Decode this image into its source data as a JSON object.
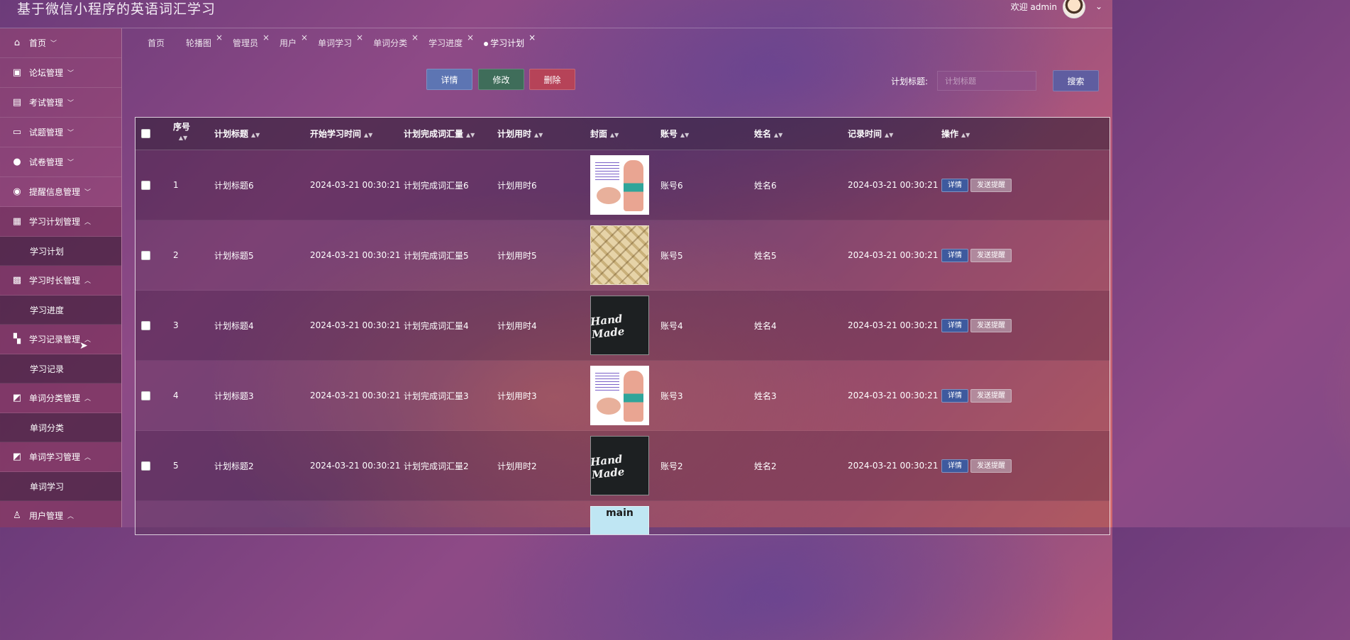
{
  "app": {
    "title": "基于微信小程序的英语词汇学习",
    "welcome": "欢迎 admin"
  },
  "sidebar": {
    "items": [
      {
        "label": "首页",
        "icon": "home-icon",
        "open": false
      },
      {
        "label": "论坛管理",
        "icon": "forum-icon",
        "open": false
      },
      {
        "label": "考试管理",
        "icon": "exam-icon",
        "open": false
      },
      {
        "label": "试题管理",
        "icon": "question-icon",
        "open": false
      },
      {
        "label": "试卷管理",
        "icon": "paper-icon",
        "open": false
      },
      {
        "label": "提醒信息管理",
        "icon": "compass-icon",
        "open": false
      },
      {
        "label": "学习计划管理",
        "icon": "briefcase-icon",
        "open": true,
        "sub": "学习计划"
      },
      {
        "label": "学习时长管理",
        "icon": "chip-icon",
        "open": true,
        "sub": "学习进度"
      },
      {
        "label": "学习记录管理",
        "icon": "grid-icon",
        "open": true,
        "sub": "学习记录"
      },
      {
        "label": "单词分类管理",
        "icon": "chart-icon",
        "open": true,
        "sub": "单词分类"
      },
      {
        "label": "单词学习管理",
        "icon": "chart-icon",
        "open": true,
        "sub": "单词学习"
      },
      {
        "label": "用户管理",
        "icon": "user-icon",
        "open": true
      }
    ]
  },
  "tabs": [
    "首页",
    "轮播图",
    "管理员",
    "用户",
    "单词学习",
    "单词分类",
    "学习进度",
    "学习计划"
  ],
  "toolbar": {
    "detail": "详情",
    "edit": "修改",
    "delete": "删除",
    "search_label": "计划标题:",
    "search_placeholder": "计划标题",
    "search": "搜索"
  },
  "table": {
    "headers": {
      "seq": "序号",
      "title": "计划标题",
      "start": "开始学习时间",
      "words": "计划完成词汇量",
      "hours": "计划用时",
      "cover": "封面",
      "account": "账号",
      "name": "姓名",
      "time": "记录时间",
      "op": "操作"
    },
    "rows": [
      {
        "no": "1",
        "title": "计划标题6",
        "start": "2024-03-21 00:30:21",
        "words": "计划完成词汇量6",
        "hours": "计划用时6",
        "cover": "anatomy",
        "account": "账号6",
        "name": "姓名6",
        "time": "2024-03-21 00:30:21"
      },
      {
        "no": "2",
        "title": "计划标题5",
        "start": "2024-03-21 00:30:21",
        "words": "计划完成词汇量5",
        "hours": "计划用时5",
        "cover": "dice",
        "account": "账号5",
        "name": "姓名5",
        "time": "2024-03-21 00:30:21"
      },
      {
        "no": "3",
        "title": "计划标题4",
        "start": "2024-03-21 00:30:21",
        "words": "计划完成词汇量4",
        "hours": "计划用时4",
        "cover": "handmade",
        "account": "账号4",
        "name": "姓名4",
        "time": "2024-03-21 00:30:21"
      },
      {
        "no": "4",
        "title": "计划标题3",
        "start": "2024-03-21 00:30:21",
        "words": "计划完成词汇量3",
        "hours": "计划用时3",
        "cover": "anatomy",
        "account": "账号3",
        "name": "姓名3",
        "time": "2024-03-21 00:30:21"
      },
      {
        "no": "5",
        "title": "计划标题2",
        "start": "2024-03-21 00:30:21",
        "words": "计划完成词汇量2",
        "hours": "计划用时2",
        "cover": "handmade",
        "account": "账号2",
        "name": "姓名2",
        "time": "2024-03-21 00:30:21"
      },
      {
        "no": "",
        "title": "",
        "start": "",
        "words": "",
        "hours": "",
        "cover": "main",
        "account": "",
        "name": "",
        "time": ""
      }
    ],
    "row_actions": {
      "detail": "详情",
      "remind": "发送提醒"
    },
    "cover_texts": {
      "handmade": "Hand Made",
      "main": "main"
    }
  }
}
